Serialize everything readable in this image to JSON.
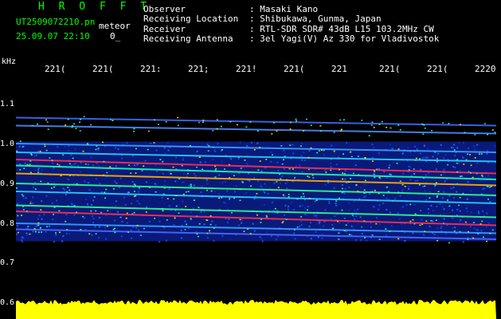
{
  "header": {
    "brand": "H R O F F T",
    "filename": "UT2509072210.pn",
    "meteor_label": "meteor",
    "datetime": "25.09.07 22:10",
    "meteor_count": "0_"
  },
  "info": [
    {
      "label": "Observer",
      "value": ": Masaki Kano"
    },
    {
      "label": "Receiving Location",
      "value": ": Shibukawa, Gunma, Japan"
    },
    {
      "label": "Receiver",
      "value": ": RTL-SDR SDR# 43dB L15 103.2MHz CW"
    },
    {
      "label": "Receiving Antenna",
      "value": ": 3el Yagi(V) Az 330 for Vladivostok"
    }
  ],
  "y_axis": {
    "unit": "kHz",
    "labels": [
      "1.1",
      "1.0",
      "0.9",
      "0.8",
      "0.7",
      "0.6"
    ]
  },
  "x_axis": {
    "labels": [
      "221(",
      "221(",
      "221:",
      "221;",
      "221!",
      "221(",
      "221",
      "221(",
      "221(",
      "2220"
    ]
  },
  "chart_data": {
    "type": "heatmap",
    "xlabel": "",
    "ylabel": "kHz",
    "ylim": [
      0.6,
      1.1
    ],
    "x_tick_labels": [
      "221(",
      "221(",
      "221:",
      "221;",
      "221!",
      "221(",
      "221",
      "221(",
      "221(",
      "2220"
    ],
    "y_tick_labels": [
      "1.1",
      "1.0",
      "0.9",
      "0.8",
      "0.7",
      "0.6"
    ],
    "traces": [
      {
        "f_start": 1.065,
        "f_end": 1.045,
        "color": "#3a6cff"
      },
      {
        "f_start": 1.045,
        "f_end": 1.025,
        "color": "#4a8cff"
      },
      {
        "f_start": 1.0,
        "f_end": 0.978,
        "color": "#3aa0ff"
      },
      {
        "f_start": 0.978,
        "f_end": 0.955,
        "color": "#2ad0ff"
      },
      {
        "f_start": 0.96,
        "f_end": 0.925,
        "color": "#ff3050"
      },
      {
        "f_start": 0.945,
        "f_end": 0.91,
        "color": "#20ffb0"
      },
      {
        "f_start": 0.925,
        "f_end": 0.895,
        "color": "#ffb000"
      },
      {
        "f_start": 0.9,
        "f_end": 0.87,
        "color": "#30ff90"
      },
      {
        "f_start": 0.88,
        "f_end": 0.85,
        "color": "#2ad0ff"
      },
      {
        "f_start": 0.845,
        "f_end": 0.815,
        "color": "#30ff90"
      },
      {
        "f_start": 0.83,
        "f_end": 0.795,
        "color": "#ff3050"
      },
      {
        "f_start": 0.8,
        "f_end": 0.775,
        "color": "#3aa0ff"
      },
      {
        "f_start": 0.785,
        "f_end": 0.76,
        "color": "#4a6cff"
      }
    ],
    "noise_band": [
      0.755,
      1.005
    ],
    "amplitude_color": "#ffff00"
  }
}
